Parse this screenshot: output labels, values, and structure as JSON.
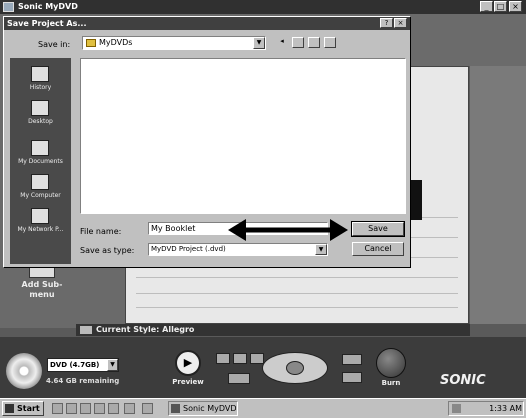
{
  "app": {
    "title": "Sonic MyDVD",
    "title_buttons": [
      "_",
      "□",
      "×"
    ],
    "add_subs_label": "Add Sub-menu",
    "style_bar_text": "Current Style: Allegro",
    "format_value": "DVD (4.7GB)",
    "disc_status": "4.64 GB remaining",
    "preview_label": "Preview",
    "burn_label": "Burn",
    "brand": "SONIC"
  },
  "dialog": {
    "title": "Save Project As...",
    "help_glyph": "?",
    "close_glyph": "×",
    "save_in_label": "Save in:",
    "save_in_value": "MyDVDs",
    "places": [
      {
        "icon": "history-icon",
        "label": "History"
      },
      {
        "icon": "desktop-icon",
        "label": "Desktop"
      },
      {
        "icon": "my-documents-icon",
        "label": "My Documents"
      },
      {
        "icon": "my-computer-icon",
        "label": "My Computer"
      },
      {
        "icon": "my-network-icon",
        "label": "My Network P..."
      }
    ],
    "file_name_label": "File name:",
    "file_name_value": "My Booklet",
    "save_as_type_label": "Save as type:",
    "save_as_type_value": "MyDVD Project (.dvd)",
    "save_button": "Save",
    "cancel_button": "Cancel",
    "dropdown_glyph": "▼"
  },
  "taskbar": {
    "start_label": "Start",
    "task_item": "Sonic MyDVD",
    "clock": "1:33 AM"
  },
  "colors": {
    "annotation_arrow": "#000000",
    "title_bar": "#303030"
  }
}
